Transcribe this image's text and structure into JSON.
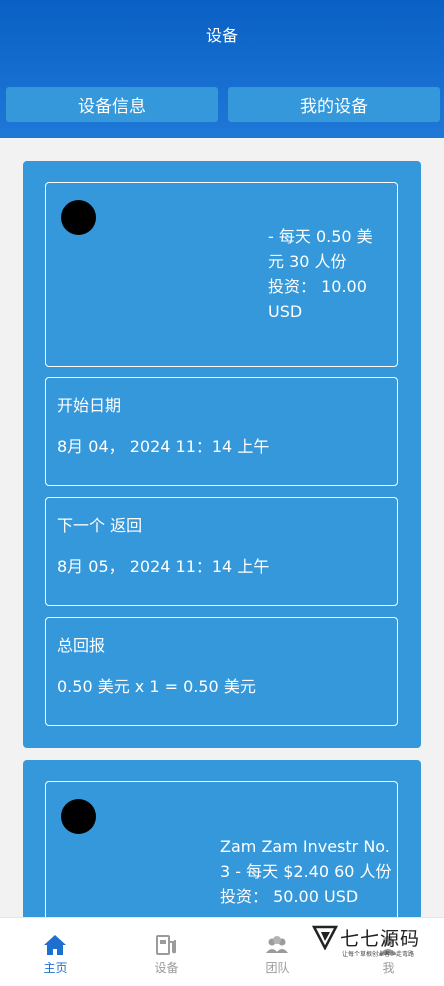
{
  "header": {
    "title": "设备"
  },
  "tabs": [
    {
      "label": "设备信息"
    },
    {
      "label": "我的设备"
    }
  ],
  "devices": [
    {
      "description_lines": [
        "- 每天 0.50 美",
        "元 30 人份",
        "投资： 10.00",
        "USD"
      ],
      "start": {
        "label": "开始日期",
        "value": "8月 04， 2024 11：14 上午"
      },
      "next": {
        "label": "下一个 返回",
        "value": "8月 05， 2024 11：14 上午"
      },
      "total": {
        "label": "总回报",
        "value": "0.50 美元 x 1 = 0.50 美元"
      }
    },
    {
      "description_lines": [
        "Zam Zam Investr No.",
        "3 - 每天 $2.40 60 人份",
        "投资： 50.00 USD"
      ]
    }
  ],
  "bottom_nav": [
    {
      "label": "主页",
      "icon": "home-icon",
      "active": true
    },
    {
      "label": "设备",
      "icon": "device-icon",
      "active": false
    },
    {
      "label": "团队",
      "icon": "team-icon",
      "active": false
    },
    {
      "label": "我",
      "icon": "user-icon",
      "active": false
    }
  ],
  "watermark": {
    "text": "七七源码",
    "subtitle": "让每个草根创业者少走弯路"
  },
  "colors": {
    "header": "#0a60c4",
    "card": "#3498db",
    "active_nav": "#1f6fd1",
    "inactive_nav": "#9b9b9b"
  }
}
